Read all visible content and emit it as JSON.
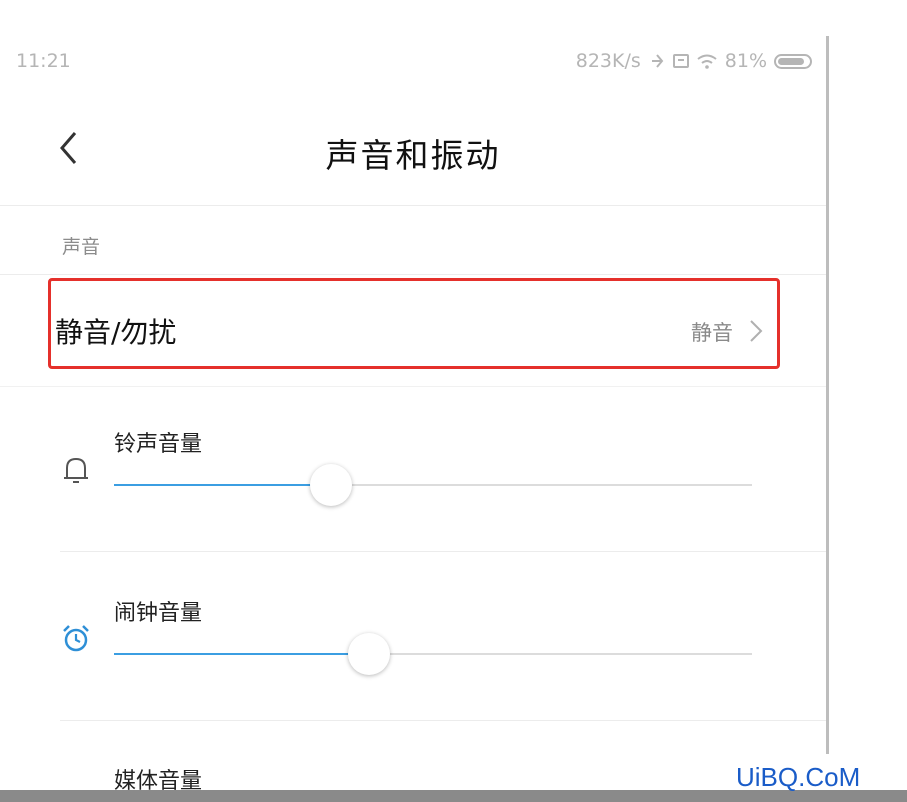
{
  "status_bar": {
    "time": "11:21",
    "speed": "823K/s",
    "battery": "81%"
  },
  "header": {
    "title": "声音和振动"
  },
  "section": {
    "label": "声音"
  },
  "mute_row": {
    "label": "静音/勿扰",
    "value": "静音"
  },
  "volumes": [
    {
      "label": "铃声音量",
      "icon": "bell-icon",
      "level": 0.34
    },
    {
      "label": "闹钟音量",
      "icon": "alarm-clock-icon",
      "level": 0.4
    },
    {
      "label": "媒体音量",
      "icon": "media-icon",
      "level": null
    }
  ],
  "watermark": "UiBQ.CoM",
  "colors": {
    "accent": "#3b9ee2",
    "highlight_box": "#e5302b"
  }
}
